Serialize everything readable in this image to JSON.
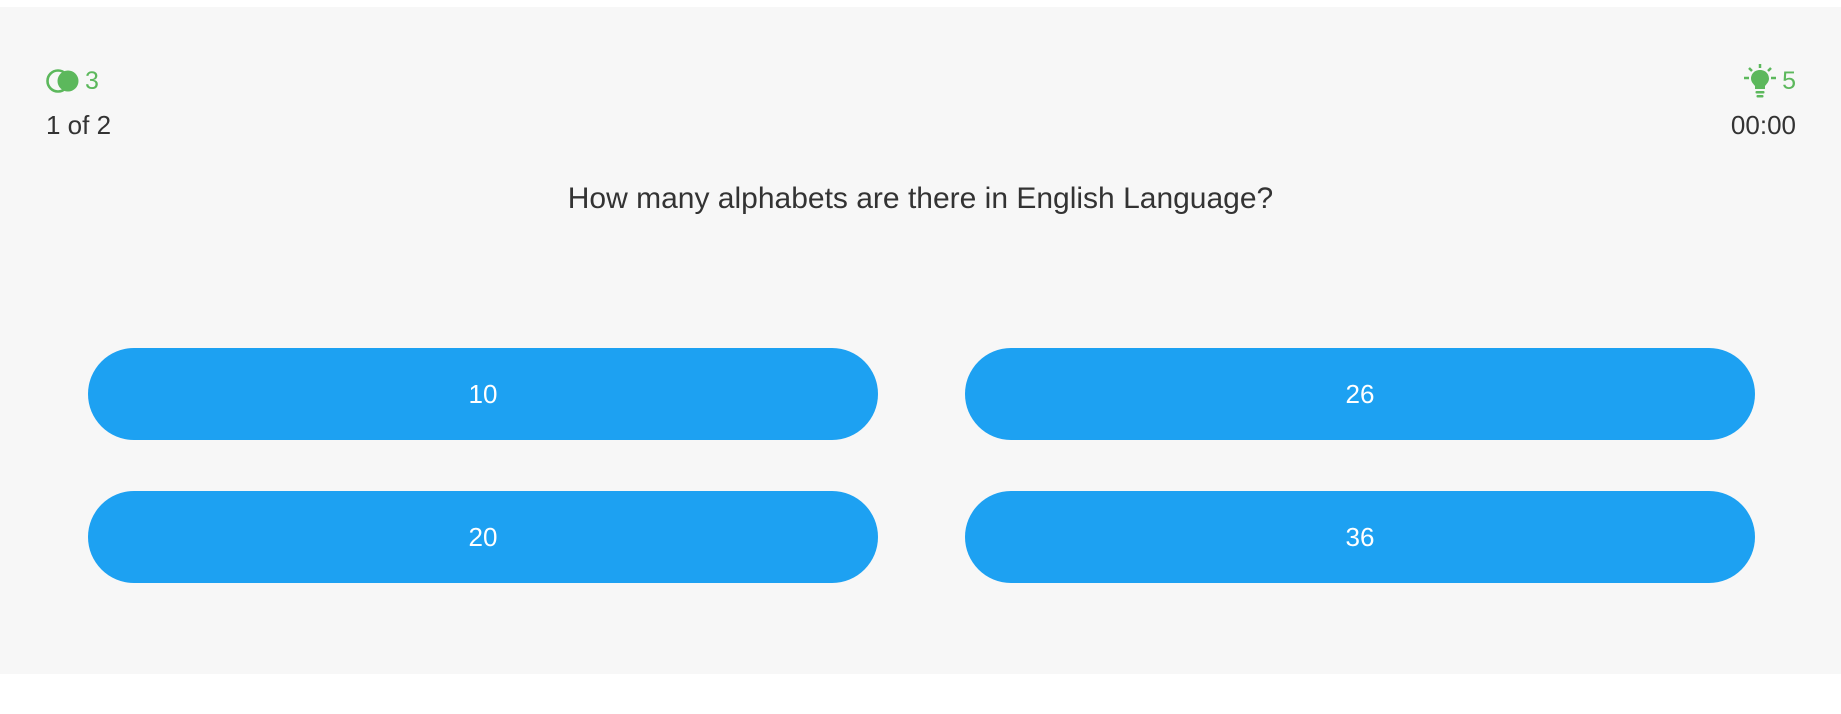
{
  "header": {
    "fifty_fifty": {
      "icon": "fifty-fifty-icon",
      "count": "3",
      "color": "#5cb85c"
    },
    "hints": {
      "icon": "lightbulb-icon",
      "count": "5",
      "color": "#5cb85c"
    },
    "progress": "1 of 2",
    "timer": "00:00"
  },
  "question": {
    "text": "How many alphabets are there in English Language?"
  },
  "answers": [
    {
      "label": "10"
    },
    {
      "label": "26"
    },
    {
      "label": "20"
    },
    {
      "label": "36"
    }
  ],
  "colors": {
    "answer_button": "#1da1f2",
    "background": "#f7f7f7",
    "text": "#333333"
  }
}
